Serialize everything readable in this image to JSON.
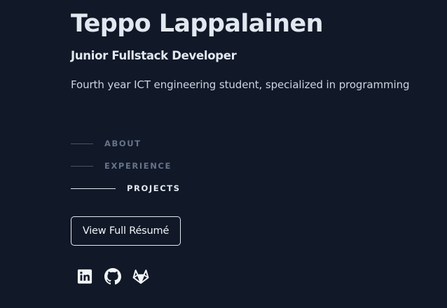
{
  "header": {
    "name": "Teppo Lappalainen",
    "role": "Junior Fullstack Developer",
    "tagline": "Fourth year ICT engineering student, specialized in programming"
  },
  "nav": {
    "items": [
      {
        "label": "ABOUT",
        "active": false
      },
      {
        "label": "EXPERIENCE",
        "active": false
      },
      {
        "label": "PROJECTS",
        "active": true
      }
    ]
  },
  "resume_button": {
    "label": "View Full Résumé"
  },
  "socials": [
    {
      "icon": "linkedin-icon"
    },
    {
      "icon": "github-icon"
    },
    {
      "icon": "gitlab-icon"
    }
  ],
  "colors": {
    "background": "#111827",
    "text": "#e2e8f0",
    "muted": "#64748b"
  }
}
